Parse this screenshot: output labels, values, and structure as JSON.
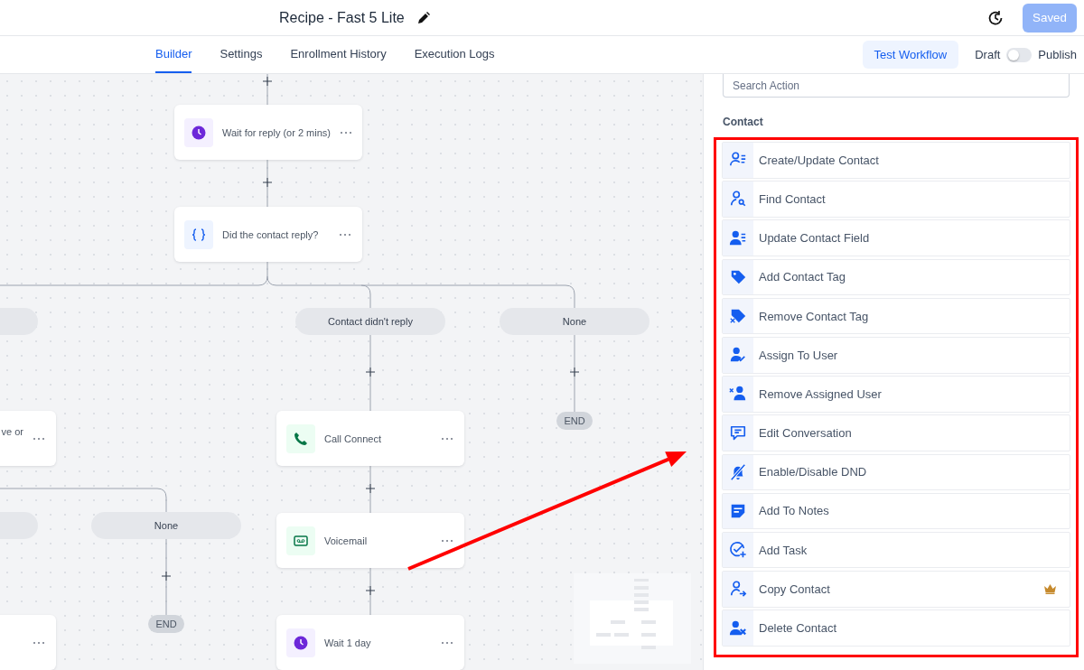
{
  "header": {
    "title": "Recipe - Fast 5 Lite",
    "save_label": "Saved"
  },
  "tabs": [
    {
      "label": "Builder",
      "selected": true
    },
    {
      "label": "Settings",
      "selected": false
    },
    {
      "label": "Enrollment History",
      "selected": false
    },
    {
      "label": "Execution Logs",
      "selected": false
    }
  ],
  "test_button": "Test Workflow",
  "status_toggle": {
    "off_label": "Draft",
    "on_label": "Publish",
    "on": false
  },
  "canvas": {
    "nodes": [
      {
        "kind": "wait",
        "label": "Wait for reply (or 2 mins)"
      },
      {
        "kind": "condition",
        "label": "Did the contact reply?"
      },
      {
        "kind": "partial",
        "label": "ve or"
      },
      {
        "kind": "call",
        "label": "Call Connect"
      },
      {
        "kind": "voicemail",
        "label": "Voicemail"
      },
      {
        "kind": "partial"
      },
      {
        "kind": "wait",
        "label": "Wait 1 day"
      }
    ],
    "branches": [
      {
        "label": "Contact didn't reply"
      },
      {
        "label": "None"
      },
      {
        "label": "None"
      }
    ],
    "ends": [
      "END",
      "END"
    ]
  },
  "panel": {
    "search_placeholder": "Search Action",
    "section": "Contact",
    "actions": [
      {
        "label": "Create/Update Contact",
        "premium": false
      },
      {
        "label": "Find Contact",
        "premium": false
      },
      {
        "label": "Update Contact Field",
        "premium": false
      },
      {
        "label": "Add Contact Tag",
        "premium": false
      },
      {
        "label": "Remove Contact Tag",
        "premium": false
      },
      {
        "label": "Assign To User",
        "premium": false
      },
      {
        "label": "Remove Assigned User",
        "premium": false
      },
      {
        "label": "Edit Conversation",
        "premium": false
      },
      {
        "label": "Enable/Disable DND",
        "premium": false
      },
      {
        "label": "Add To Notes",
        "premium": false
      },
      {
        "label": "Add Task",
        "premium": false
      },
      {
        "label": "Copy Contact",
        "premium": true
      },
      {
        "label": "Delete Contact",
        "premium": false
      }
    ]
  }
}
